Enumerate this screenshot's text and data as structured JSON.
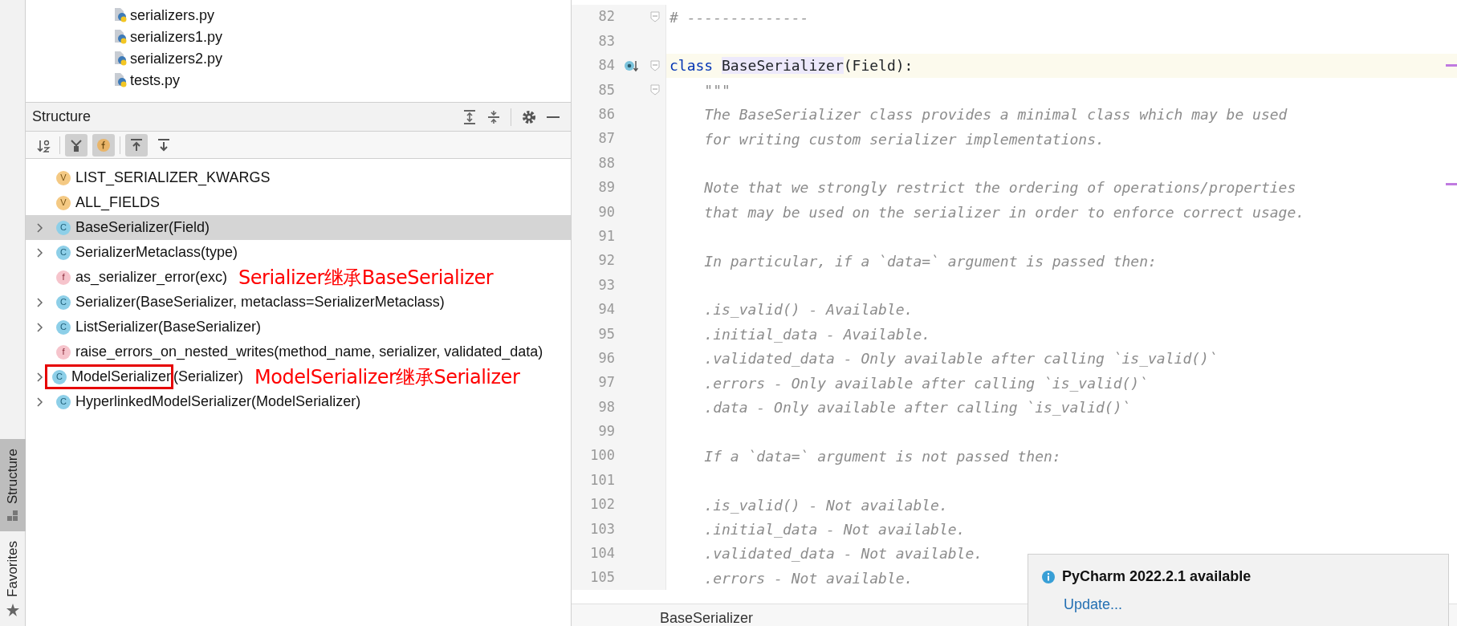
{
  "side_strip": [
    {
      "label": "Structure",
      "selected": true
    },
    {
      "label": "Favorites",
      "selected": false
    }
  ],
  "project_files": [
    {
      "name": "serializers.py"
    },
    {
      "name": "serializers1.py"
    },
    {
      "name": "serializers2.py"
    },
    {
      "name": "tests.py"
    }
  ],
  "structure": {
    "title": "Structure",
    "toolbar": [
      {
        "kind": "sort",
        "selected": false
      },
      {
        "kind": "inherited",
        "selected": true
      },
      {
        "kind": "fields",
        "selected": true
      },
      {
        "kind": "scroll-from",
        "selected": true
      },
      {
        "kind": "scroll-to",
        "selected": false
      }
    ],
    "items": [
      {
        "kind": "variable",
        "badge": "V",
        "label": "LIST_SERIALIZER_KWARGS",
        "expandable": false,
        "selected": false
      },
      {
        "kind": "variable",
        "badge": "V",
        "label": "ALL_FIELDS",
        "expandable": false,
        "selected": false
      },
      {
        "kind": "class",
        "badge": "C",
        "label": "BaseSerializer(Field)",
        "expandable": true,
        "selected": true
      },
      {
        "kind": "class",
        "badge": "C",
        "label": "SerializerMetaclass(type)",
        "expandable": true,
        "selected": false
      },
      {
        "kind": "function",
        "badge": "f",
        "label": "as_serializer_error(exc)",
        "expandable": false,
        "selected": false,
        "note": "Serializer继承BaseSerializer"
      },
      {
        "kind": "class",
        "badge": "C",
        "label": "Serializer(BaseSerializer, metaclass=SerializerMetaclass)",
        "expandable": true,
        "selected": false
      },
      {
        "kind": "class",
        "badge": "C",
        "label": "ListSerializer(BaseSerializer)",
        "expandable": true,
        "selected": false
      },
      {
        "kind": "function",
        "badge": "f",
        "label": "raise_errors_on_nested_writes(method_name, serializer, validated_data)",
        "expandable": false,
        "selected": false
      },
      {
        "kind": "class",
        "badge": "C",
        "label": "ModelSerializer",
        "label_suffix": "(Serializer)",
        "boxed": true,
        "expandable": true,
        "selected": false,
        "note": "ModelSerializer继承Serializer"
      },
      {
        "kind": "class",
        "badge": "C",
        "label": "HyperlinkedModelSerializer(ModelSerializer)",
        "expandable": true,
        "selected": false
      }
    ]
  },
  "editor": {
    "lines": [
      {
        "number": "82",
        "kind": "comment",
        "text": "# --------------",
        "fold": true
      },
      {
        "number": "83",
        "kind": "blank"
      },
      {
        "number": "84",
        "kind": "class_def",
        "keyword": "class",
        "name": "BaseSerializer",
        "rest": "(Field):",
        "fold": true,
        "current": true,
        "marker": true
      },
      {
        "number": "85",
        "kind": "doc",
        "text": "    \"\"\"",
        "fold": true
      },
      {
        "number": "86",
        "kind": "doc",
        "text": "    The BaseSerializer class provides a minimal class which may be used"
      },
      {
        "number": "87",
        "kind": "doc",
        "text": "    for writing custom serializer implementations."
      },
      {
        "number": "88",
        "kind": "blank"
      },
      {
        "number": "89",
        "kind": "doc",
        "text": "    Note that we strongly restrict the ordering of operations/properties"
      },
      {
        "number": "90",
        "kind": "doc",
        "text": "    that may be used on the serializer in order to enforce correct usage."
      },
      {
        "number": "91",
        "kind": "blank"
      },
      {
        "number": "92",
        "kind": "doc",
        "text": "    In particular, if a `data=` argument is passed then:"
      },
      {
        "number": "93",
        "kind": "blank"
      },
      {
        "number": "94",
        "kind": "doc",
        "text": "    .is_valid() - Available."
      },
      {
        "number": "95",
        "kind": "doc",
        "text": "    .initial_data - Available."
      },
      {
        "number": "96",
        "kind": "doc",
        "text": "    .validated_data - Only available after calling `is_valid()`"
      },
      {
        "number": "97",
        "kind": "doc",
        "text": "    .errors - Only available after calling `is_valid()`"
      },
      {
        "number": "98",
        "kind": "doc",
        "text": "    .data - Only available after calling `is_valid()`"
      },
      {
        "number": "99",
        "kind": "blank"
      },
      {
        "number": "100",
        "kind": "doc",
        "text": "    If a `data=` argument is not passed then:"
      },
      {
        "number": "101",
        "kind": "blank"
      },
      {
        "number": "102",
        "kind": "doc",
        "text": "    .is_valid() - Not available."
      },
      {
        "number": "103",
        "kind": "doc",
        "text": "    .initial_data - Not available."
      },
      {
        "number": "104",
        "kind": "doc",
        "text": "    .validated_data - Not available."
      },
      {
        "number": "105",
        "kind": "doc",
        "text": "    .errors - Not available."
      }
    ],
    "breadcrumb": "BaseSerializer"
  },
  "notification": {
    "title": "PyCharm 2022.2.1 available",
    "link": "Update..."
  }
}
